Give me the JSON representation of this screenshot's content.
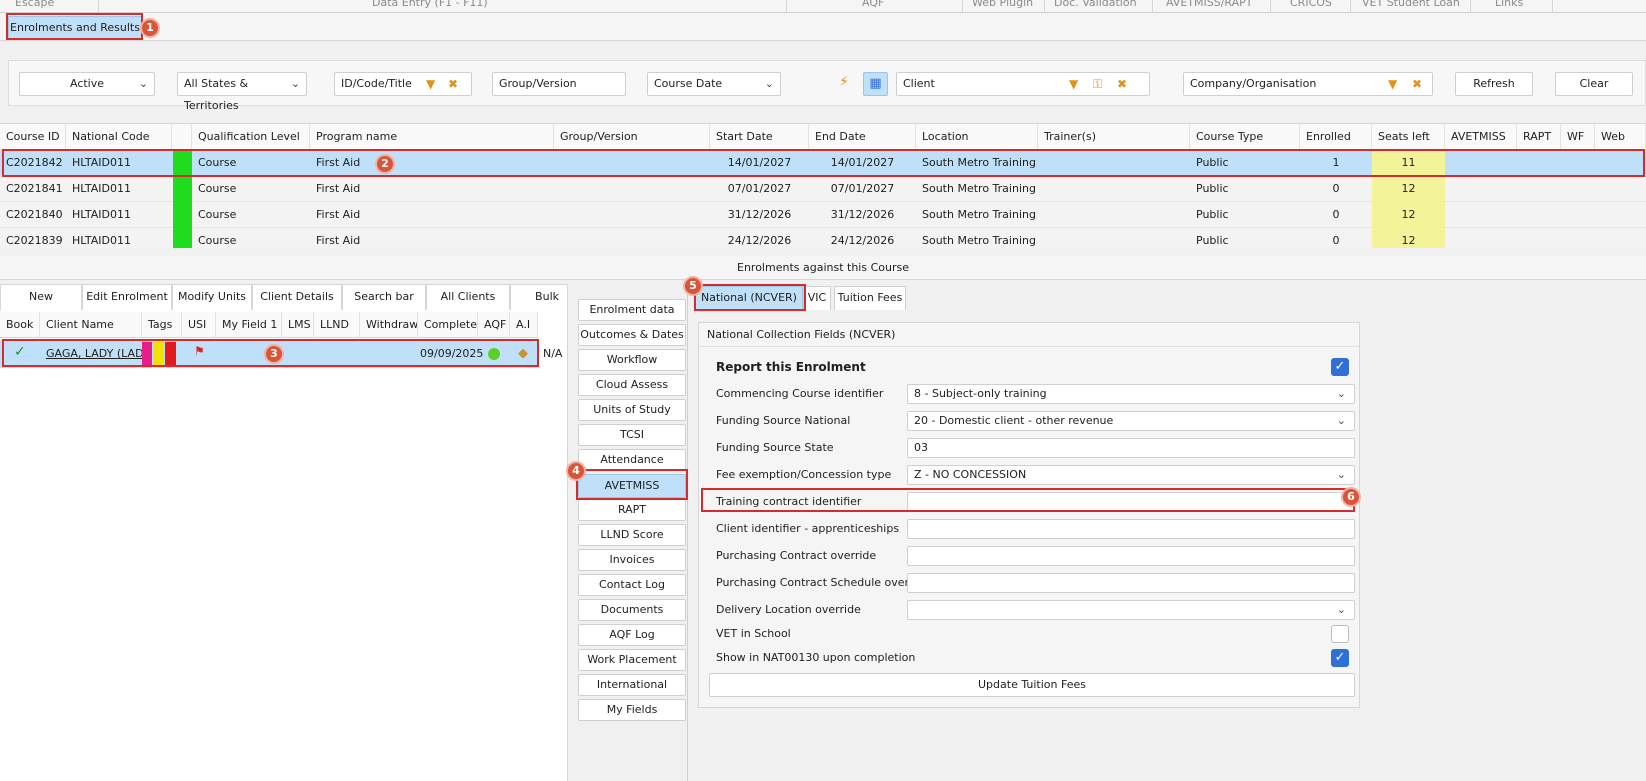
{
  "top_menu": [
    "Escape",
    "Data Entry (F1 - F11)",
    "AQF",
    "Web Plugin",
    "Doc. Validation",
    "AVETMISS/RAPT",
    "CRICOS",
    "VET Student Loan",
    "Links"
  ],
  "main_tab": "Enrolments and Results",
  "filters": {
    "status": "Active",
    "states": "All States & Territories",
    "id_code_title_placeholder": "ID/Code/Title",
    "group_version_placeholder": "Group/Version",
    "course_date": "Course Date",
    "client_placeholder": "Client",
    "company_placeholder": "Company/Organisation",
    "refresh_label": "Refresh",
    "clear_label": "Clear"
  },
  "course_grid": {
    "columns": [
      "Course ID",
      "National Code",
      "",
      "Qualification Level",
      "Program name",
      "Group/Version",
      "Start Date",
      "End Date",
      "Location",
      "Trainer(s)",
      "Course Type",
      "Enrolled",
      "Seats left",
      "AVETMISS",
      "RAPT",
      "WF",
      "Web"
    ],
    "rows": [
      {
        "course_id": "C2021842",
        "national_code": "HLTAID011",
        "qualification_level": "Course",
        "program_name": "First Aid",
        "group_version": "",
        "start_date": "14/01/2027",
        "end_date": "14/01/2027",
        "location": "South Metro Training C",
        "trainers": "",
        "course_type": "Public",
        "enrolled": "1",
        "seats_left": "11"
      },
      {
        "course_id": "C2021841",
        "national_code": "HLTAID011",
        "qualification_level": "Course",
        "program_name": "First Aid",
        "group_version": "",
        "start_date": "07/01/2027",
        "end_date": "07/01/2027",
        "location": "South Metro Training C",
        "trainers": "",
        "course_type": "Public",
        "enrolled": "0",
        "seats_left": "12"
      },
      {
        "course_id": "C2021840",
        "national_code": "HLTAID011",
        "qualification_level": "Course",
        "program_name": "First Aid",
        "group_version": "",
        "start_date": "31/12/2026",
        "end_date": "31/12/2026",
        "location": "South Metro Training C",
        "trainers": "",
        "course_type": "Public",
        "enrolled": "0",
        "seats_left": "12"
      },
      {
        "course_id": "C2021839",
        "national_code": "HLTAID011",
        "qualification_level": "Course",
        "program_name": "First Aid",
        "group_version": "",
        "start_date": "24/12/2026",
        "end_date": "24/12/2026",
        "location": "South Metro Training C",
        "trainers": "",
        "course_type": "Public",
        "enrolled": "0",
        "seats_left": "12"
      }
    ]
  },
  "enrolments_header": "Enrolments against this Course",
  "enrol_tabs": [
    "New Enrolment",
    "Edit Enrolment",
    "Modify Units",
    "Client Details",
    "Search bar",
    "All Clients",
    "Bulk"
  ],
  "enrol_grid": {
    "columns": [
      "Book",
      "Client Name",
      "Tags",
      "USI",
      "My Field 1",
      "LMS",
      "LLND",
      "Withdraw",
      "Complete",
      "AQF",
      "A.I"
    ],
    "row": {
      "client_name": "GAGA, LADY (LAD",
      "complete": "09/09/2025",
      "na": "N/A"
    }
  },
  "nav_items": [
    "Enrolment data",
    "Outcomes & Dates",
    "Workflow",
    "Cloud Assess",
    "Units of Study",
    "TCSI",
    "Attendance",
    "AVETMISS",
    "RAPT",
    "LLND Score",
    "Invoices",
    "Contact Log",
    "Documents",
    "AQF Log",
    "Work Placement",
    "International",
    "My Fields"
  ],
  "right_tabs": [
    "National (NCVER)",
    "VIC",
    "Tuition Fees"
  ],
  "ncver": {
    "group_title": "National Collection Fields (NCVER)",
    "report_label": "Report this Enrolment",
    "report_checked": true,
    "fields": [
      {
        "label": "Commencing Course identifier",
        "value": "8 - Subject-only training",
        "dropdown": true
      },
      {
        "label": "Funding Source National",
        "value": "20 - Domestic client - other revenue",
        "dropdown": true
      },
      {
        "label": "Funding Source State",
        "value": "03",
        "dropdown": false
      },
      {
        "label": "Fee exemption/Concession type",
        "value": "Z - NO CONCESSION",
        "dropdown": true
      },
      {
        "label": "Training contract identifier",
        "value": "",
        "dropdown": false
      },
      {
        "label": "Client identifier - apprenticeships",
        "value": "",
        "dropdown": false
      },
      {
        "label": "Purchasing Contract override",
        "value": "",
        "dropdown": false
      },
      {
        "label": "Purchasing Contract Schedule override",
        "value": "",
        "dropdown": false
      },
      {
        "label": "Delivery Location override",
        "value": "",
        "dropdown": true
      }
    ],
    "vet_in_school_label": "VET in School",
    "vet_in_school_checked": false,
    "nat130_label": "Show in NAT00130 upon completion",
    "nat130_checked": true,
    "update_button": "Update Tuition Fees"
  },
  "badges": [
    "1",
    "2",
    "3",
    "4",
    "5",
    "6"
  ],
  "colors": {
    "selected": "#bfe0f8",
    "green_status": "#1fdc1f",
    "seats_yellow": "#f3f39a",
    "marker_red": "#d42c2c",
    "badge": "#d8553a",
    "checkbox": "#2f6fd6"
  }
}
